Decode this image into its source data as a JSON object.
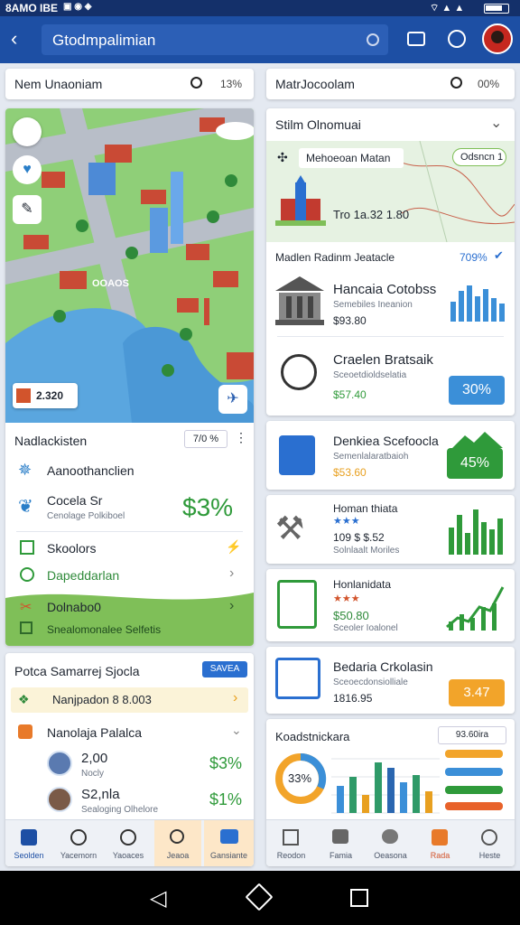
{
  "status": {
    "time": "8AMO IBE"
  },
  "appbar": {
    "search_text": "Gtodmpalimian"
  },
  "left": {
    "search": {
      "value": "Nem Unaoniam",
      "count": "13%"
    },
    "map": {
      "price_badge": "2.320",
      "location_label": "OOAOS"
    },
    "list_title": "Nadlackisten",
    "list_badge": "7/0 %",
    "items": [
      {
        "label": "Aanoothanclien"
      },
      {
        "label": "Cocela Sr",
        "sub": "Cenolage Polkiboel",
        "value": "$3%"
      },
      {
        "label": "Skoolors"
      },
      {
        "label": "Dapeddarlan"
      },
      {
        "label": "Dolnabo0",
        "sub": "Snealomonalee Selfetis"
      }
    ]
  },
  "left2": {
    "title": "Potca Samarrej Sjocla",
    "badge": "SAVEA",
    "highlight": "Nanjpadon 8 8.003",
    "section": "Nanolaja Palalca",
    "people": [
      {
        "value": "2,00",
        "sub": "Nocly",
        "percent": "$3%"
      },
      {
        "value": "S2,nla",
        "sub": "Sealoging Olhelore",
        "percent": "$1%"
      }
    ],
    "nav": [
      "Seolden",
      "Yacemorn",
      "Yaoaces",
      "Jeaoa",
      "Gansiante"
    ]
  },
  "right": {
    "search": {
      "value": "MatrJocoolam",
      "count": "00%"
    },
    "section_title": "Stilm Olnomuai",
    "banner": {
      "title": "Mehoeoan Matan",
      "price": "Tro 1a.32 1.80",
      "tag": "Odsncn 1"
    },
    "list_header": "Madlen Radinm Jeatacle",
    "list_header_badge": "709%",
    "items": [
      {
        "title": "Hancaia Cotobss",
        "sub": "Semebiles Ineanion",
        "price": "$93.80"
      },
      {
        "title": "Craelen Bratsaik",
        "sub": "Sceoetdioldselatia",
        "price": "$57.40",
        "badge": "30%"
      },
      {
        "title": "Denkiea Scefoocla",
        "sub": "Semenlalaratbaioh",
        "price": "$53.60",
        "badge": "45%"
      },
      {
        "title": "Homan thiata",
        "stars": "★★★",
        "price": "109 $ $.52",
        "sub": "Solnlaalt Moriles"
      },
      {
        "title": "Honlanidata",
        "stars": "★★★",
        "price": "$50.80",
        "sub": "Sceoler Ioalonel"
      },
      {
        "title": "Bedaria Crkolasin",
        "sub": "Sceoecdonsiolliale",
        "price": "1816.95",
        "badge": "3.47"
      }
    ],
    "bottom": {
      "title": "Koadstnickara",
      "badge": "93.60ira",
      "donut": "33%"
    },
    "nav": [
      "Reodon",
      "Famia",
      "Oeasona",
      "Rada",
      "Heste"
    ],
    "bar_colors": [
      "#3b8fd8",
      "#2f9a68",
      "#e8a020",
      "#2a66b0"
    ]
  }
}
